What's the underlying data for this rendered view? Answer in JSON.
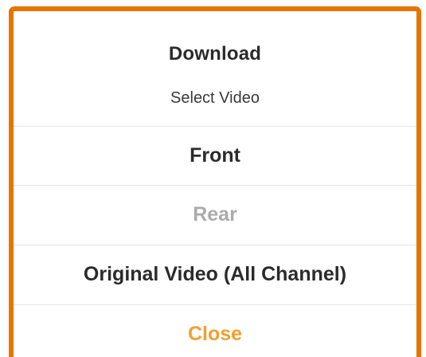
{
  "dialog": {
    "title": "Download",
    "subtitle": "Select Video",
    "options": [
      {
        "label": "Front",
        "enabled": true
      },
      {
        "label": "Rear",
        "enabled": false
      },
      {
        "label": "Original Video (All Channel)",
        "enabled": true
      }
    ],
    "close_label": "Close"
  },
  "colors": {
    "frame_accent": "#e87400",
    "text_primary": "#2b2b2b",
    "text_disabled": "#ababab",
    "close_accent": "#f0a030",
    "divider": "#e4e4e4"
  }
}
